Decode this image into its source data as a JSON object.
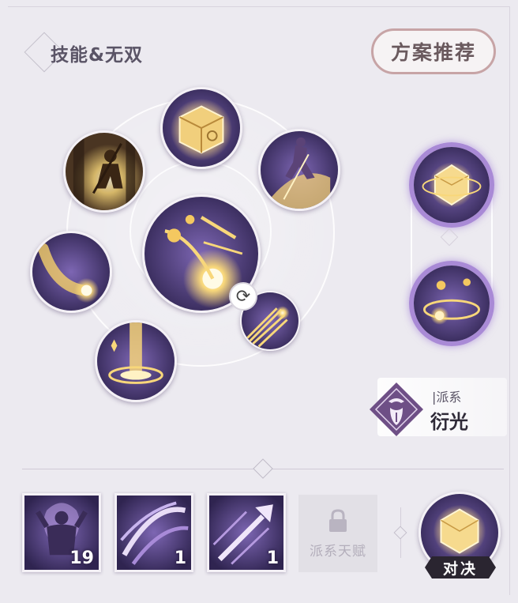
{
  "header": {
    "title": "技能&无双",
    "recommend_button": "方案推荐"
  },
  "skills": [
    {
      "name": "skill-cube",
      "icon": "golden-cube"
    },
    {
      "name": "skill-warrior-left",
      "icon": "warrior-silhouette"
    },
    {
      "name": "skill-warrior-right",
      "icon": "leaping-figure"
    },
    {
      "name": "skill-center",
      "icon": "meteor-burst"
    },
    {
      "name": "skill-comet",
      "icon": "comet"
    },
    {
      "name": "skill-light-pillar",
      "icon": "light-pillar"
    },
    {
      "name": "skill-small-burst",
      "icon": "radial-burst"
    }
  ],
  "ultimates": [
    {
      "name": "ult-crystal-orb",
      "icon": "crystal-orb"
    },
    {
      "name": "ult-orbs",
      "icon": "orbiting-spheres"
    }
  ],
  "faction": {
    "sub_label": "|派系",
    "name": "衍光"
  },
  "bottom_cards": [
    {
      "icon": "muscle-figure",
      "count": "19"
    },
    {
      "icon": "slash-arcs",
      "count": "1"
    },
    {
      "icon": "arrow-streak",
      "count": "1"
    }
  ],
  "locked_talent": {
    "label": "派系天赋"
  },
  "duel": {
    "label": "对决"
  },
  "colors": {
    "background": "#eceaf0",
    "accent_purple": "#a98ad6",
    "button_border": "#c7a4a6",
    "skill_dark": "#3b2d5f",
    "skill_gold": "#f4c860"
  }
}
